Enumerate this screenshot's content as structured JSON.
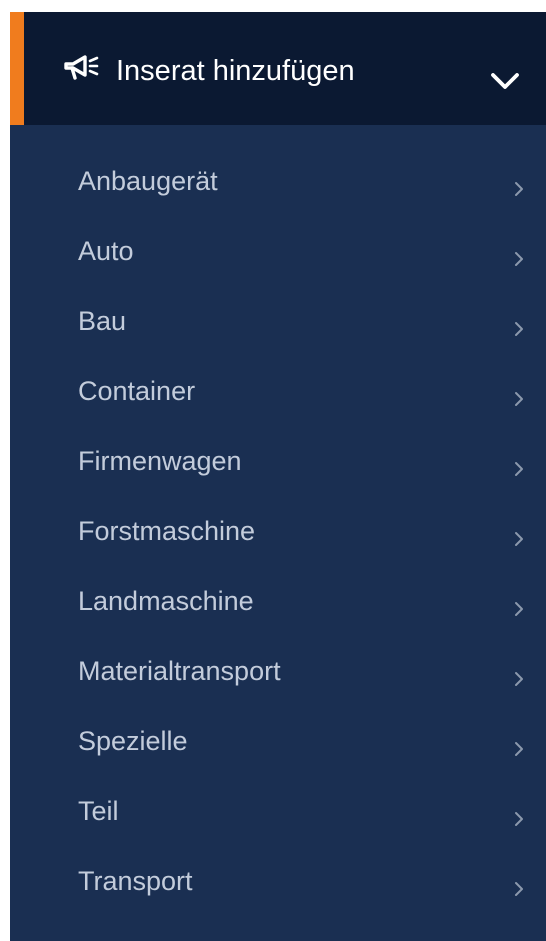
{
  "header": {
    "title": "Inserat hinzufügen",
    "icon": "megaphone-icon",
    "toggle_icon": "chevron-down-icon",
    "accent_color": "#f07c1e",
    "background_color": "#0b1932"
  },
  "menu": {
    "background_color": "#1a2f52",
    "item_icon": "chevron-right-icon",
    "items": [
      {
        "label": "Anbaugerät"
      },
      {
        "label": "Auto"
      },
      {
        "label": "Bau"
      },
      {
        "label": "Container"
      },
      {
        "label": "Firmenwagen"
      },
      {
        "label": "Forstmaschine"
      },
      {
        "label": "Landmaschine"
      },
      {
        "label": "Materialtransport"
      },
      {
        "label": "Spezielle"
      },
      {
        "label": "Teil"
      },
      {
        "label": "Transport"
      }
    ]
  }
}
